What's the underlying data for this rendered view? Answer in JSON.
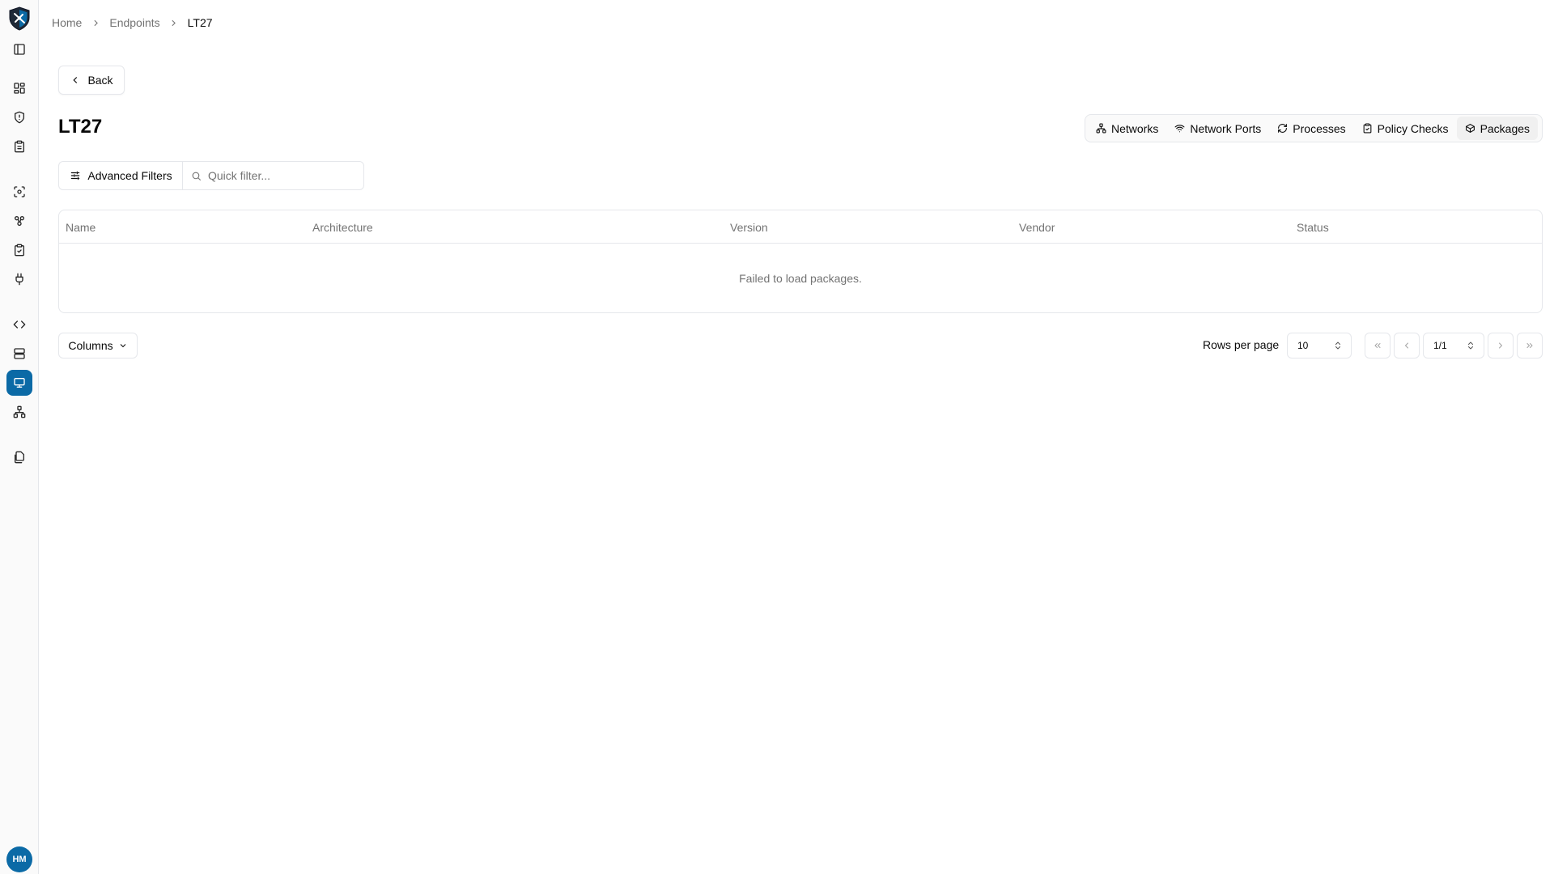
{
  "sidebar": {
    "avatar_initials": "HM"
  },
  "breadcrumb": {
    "items": [
      "Home",
      "Endpoints",
      "LT27"
    ]
  },
  "back_button": {
    "label": "Back"
  },
  "page_title": "LT27",
  "tabs": [
    {
      "label": "Networks",
      "icon": "network-icon"
    },
    {
      "label": "Network Ports",
      "icon": "wifi-icon"
    },
    {
      "label": "Processes",
      "icon": "refresh-icon"
    },
    {
      "label": "Policy Checks",
      "icon": "clipboard-check-icon"
    },
    {
      "label": "Packages",
      "icon": "package-icon",
      "active": true
    }
  ],
  "filters": {
    "advanced_label": "Advanced Filters",
    "quick_placeholder": "Quick filter..."
  },
  "table": {
    "columns": [
      "Name",
      "Architecture",
      "Version",
      "Vendor",
      "Status"
    ],
    "empty_message": "Failed to load packages."
  },
  "footer": {
    "columns_label": "Columns",
    "rows_per_page_label": "Rows per page",
    "rows_per_page_value": "10",
    "page_value": "1/1"
  },
  "colors": {
    "accent": "#0b6aa6",
    "border": "#e5e7eb",
    "muted_text": "#737373"
  }
}
